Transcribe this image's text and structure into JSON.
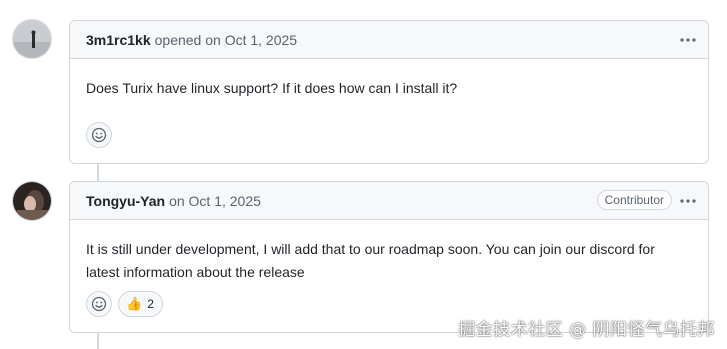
{
  "comments": [
    {
      "author": "3m1rc1kk",
      "meta": "opened on Oct 1, 2025",
      "body": "Does Turix have linux support? If it does how can I install it?",
      "badge": ""
    },
    {
      "author": "Tongyu-Yan",
      "meta": "on Oct 1, 2025",
      "body": "It is still under development, I will add that to our roadmap soon. You can join our discord for latest information about the release",
      "badge": "Contributor",
      "reaction_emoji": "👍",
      "reaction_count": "2"
    }
  ],
  "watermark": "掘金技术社区 @ 阴阳怪气乌托邦",
  "colors": {
    "border": "#d0d7de",
    "header_bg": "#f6f8fa",
    "muted": "#59636e"
  },
  "icons": [
    "kebab-menu-icon",
    "smiley-add-reaction-icon",
    "thumbs-up-emoji"
  ]
}
